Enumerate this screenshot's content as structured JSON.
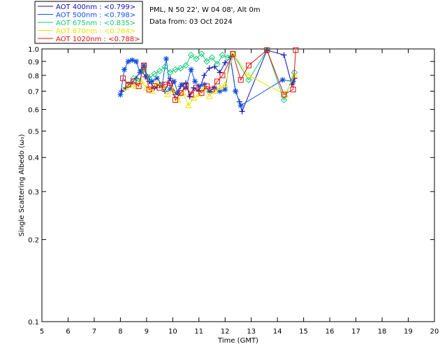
{
  "header": {
    "site_line": "PML, N 50 22', W 04 08', Alt 0m",
    "date_line": "Data from: 03 Oct 2024"
  },
  "chart_data": {
    "type": "scatter",
    "xlabel": "Time (GMT)",
    "ylabel": "Single Scattering Albedo (ω₀)",
    "xlim": [
      5,
      20
    ],
    "ylim": [
      0.1,
      1.0
    ],
    "yscale": "log",
    "x_ticks": [
      5,
      6,
      7,
      8,
      9,
      10,
      11,
      12,
      13,
      14,
      15,
      16,
      17,
      18,
      19,
      20
    ],
    "y_ticks": [
      {
        "value": 0.1,
        "label": "0.1"
      },
      {
        "value": 0.2,
        "label": "0.2"
      },
      {
        "value": 0.3,
        "label": "0.3"
      },
      {
        "value": 0.4,
        "label": "0.4"
      },
      {
        "value": 0.5,
        "label": "0.5"
      },
      {
        "value": 0.6,
        "label": "0.6"
      },
      {
        "value": 0.7,
        "label": "0.7"
      },
      {
        "value": 0.8,
        "label": "0.8"
      },
      {
        "value": 0.9,
        "label": "0.9"
      },
      {
        "value": 1.0,
        "label": "1.0"
      }
    ],
    "grid": false,
    "legend_position": "top-left, outside plot",
    "series": [
      {
        "name": "AOT  400nm : <0.799>",
        "color": "#1010b0",
        "marker": "plus",
        "x": [
          8.05,
          8.2,
          8.4,
          8.6,
          8.8,
          8.95,
          9.1,
          9.3,
          9.5,
          9.7,
          9.9,
          10.1,
          10.3,
          10.5,
          10.65,
          10.8,
          11.0,
          11.2,
          11.4,
          11.6,
          11.8,
          12.0,
          12.2,
          12.4,
          12.55,
          12.65,
          13.6,
          14.25,
          14.55,
          14.65
        ],
        "y": [
          0.7,
          0.72,
          0.75,
          0.78,
          0.84,
          0.79,
          0.76,
          0.72,
          0.74,
          0.7,
          0.78,
          0.68,
          0.73,
          0.75,
          0.67,
          0.72,
          0.7,
          0.8,
          0.85,
          0.86,
          0.82,
          0.89,
          0.93,
          0.7,
          0.64,
          0.59,
          0.99,
          0.95,
          0.74,
          0.78
        ]
      },
      {
        "name": "AOT  500nm : <0.798>",
        "color": "#1050e0",
        "marker": "star",
        "x": [
          8.0,
          8.15,
          8.3,
          8.45,
          8.6,
          8.75,
          8.9,
          9.05,
          9.2,
          9.4,
          9.6,
          9.75,
          9.9,
          10.05,
          10.2,
          10.35,
          10.5,
          10.7,
          10.85,
          11.0,
          11.2,
          11.4,
          11.6,
          11.8,
          12.0,
          12.2,
          12.4,
          12.6,
          14.2,
          14.6
        ],
        "y": [
          0.68,
          0.84,
          0.9,
          0.91,
          0.9,
          0.82,
          0.87,
          0.79,
          0.76,
          0.78,
          0.74,
          0.92,
          0.71,
          0.76,
          0.69,
          0.74,
          0.72,
          0.84,
          0.76,
          0.73,
          0.74,
          0.7,
          0.72,
          0.7,
          0.71,
          0.93,
          0.7,
          0.62,
          0.77,
          0.76
        ]
      },
      {
        "name": "AOT  675nm : <0.835>",
        "color": "#10c878",
        "marker": "diamond",
        "x": [
          8.3,
          8.5,
          8.7,
          8.9,
          9.1,
          9.3,
          9.5,
          9.7,
          9.9,
          10.1,
          10.3,
          10.5,
          10.7,
          10.9,
          11.1,
          11.3,
          11.5,
          11.7,
          11.9,
          12.1,
          12.3,
          12.9,
          13.6,
          14.25,
          14.65
        ],
        "y": [
          0.74,
          0.78,
          0.76,
          0.84,
          0.78,
          0.81,
          0.83,
          0.86,
          0.82,
          0.84,
          0.85,
          0.87,
          0.95,
          0.92,
          0.96,
          0.9,
          0.93,
          0.88,
          0.95,
          0.93,
          0.96,
          0.77,
          0.99,
          0.65,
          0.82
        ]
      },
      {
        "name": "AOT  870nm : <0.784>",
        "color": "#e6e600",
        "marker": "triangle",
        "x": [
          8.2,
          8.4,
          8.6,
          8.8,
          9.0,
          9.2,
          9.4,
          9.6,
          9.8,
          10.0,
          10.2,
          10.4,
          10.6,
          10.8,
          11.0,
          11.2,
          11.4,
          11.6,
          11.8,
          12.0,
          12.3,
          12.9,
          14.3,
          14.65
        ],
        "y": [
          0.72,
          0.74,
          0.73,
          0.76,
          0.72,
          0.7,
          0.75,
          0.73,
          0.68,
          0.71,
          0.65,
          0.69,
          0.62,
          0.66,
          0.68,
          0.72,
          0.67,
          0.7,
          0.72,
          0.74,
          0.96,
          0.8,
          0.68,
          0.8
        ]
      },
      {
        "name": "AOT 1020nm : <0.788>",
        "color": "#e01010",
        "marker": "square",
        "x": [
          8.1,
          8.3,
          8.5,
          8.7,
          8.9,
          9.1,
          9.3,
          9.5,
          9.7,
          9.9,
          10.1,
          10.3,
          10.5,
          10.7,
          10.9,
          11.1,
          11.3,
          11.5,
          11.7,
          11.9,
          12.3,
          12.6,
          12.9,
          13.6,
          14.25,
          14.6,
          14.7
        ],
        "y": [
          0.78,
          0.74,
          0.76,
          0.73,
          0.87,
          0.71,
          0.73,
          0.72,
          0.74,
          0.75,
          0.65,
          0.69,
          0.73,
          0.68,
          0.72,
          0.69,
          0.73,
          0.71,
          0.76,
          0.8,
          0.96,
          0.77,
          0.87,
          0.99,
          0.68,
          0.71,
          0.99
        ]
      }
    ]
  }
}
